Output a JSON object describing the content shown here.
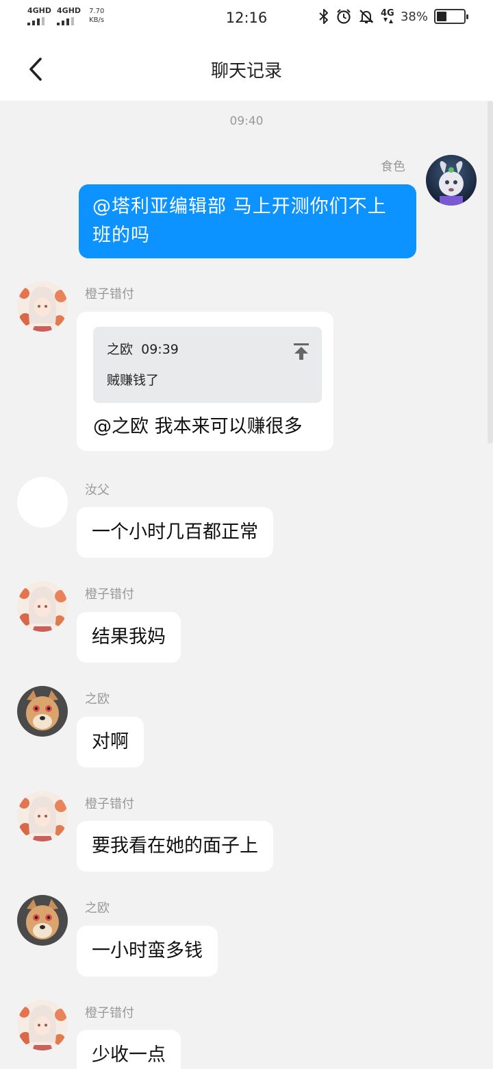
{
  "status_bar": {
    "sim1": "4GHD",
    "sim2": "4GHD",
    "net_speed": "7.70",
    "net_speed_unit": "KB/s",
    "time": "12:16",
    "network": "4G",
    "battery_percent": "38%",
    "battery_level": 0.38
  },
  "header": {
    "title": "聊天记录"
  },
  "chat": {
    "timestamp": "09:40",
    "messages": [
      {
        "sender": "食色",
        "text": "@塔利亚编辑部 马上开测你们不上班的吗",
        "outgoing": true
      },
      {
        "sender": "橙子错付",
        "quote_author": "之欧",
        "quote_time": "09:39",
        "quote_text": "贼赚钱了",
        "text": "@之欧 我本来可以赚很多"
      },
      {
        "sender": "汝父",
        "text": "一个小时几百都正常"
      },
      {
        "sender": "橙子错付",
        "text": "结果我妈"
      },
      {
        "sender": "之欧",
        "text": "对啊"
      },
      {
        "sender": "橙子错付",
        "text": "要我看在她的面子上"
      },
      {
        "sender": "之欧",
        "text": "一小时蛮多钱"
      },
      {
        "sender": "橙子错付",
        "text": "少收一点"
      }
    ]
  },
  "colors": {
    "outgoing_bubble": "#0c93ff",
    "incoming_bubble": "#ffffff",
    "background": "#f2f2f2"
  }
}
